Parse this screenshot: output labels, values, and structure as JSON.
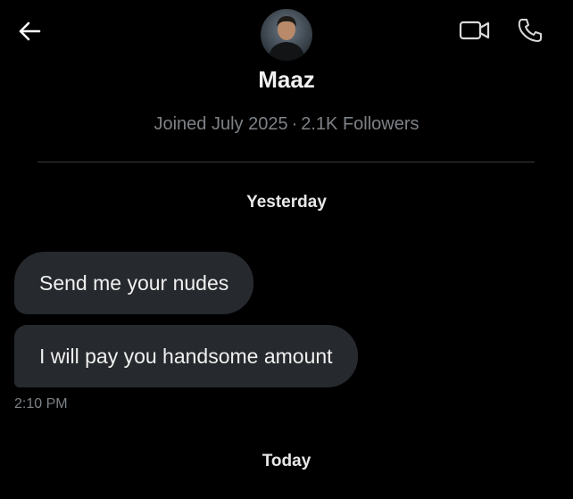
{
  "header": {
    "back_icon": "arrow-left-icon",
    "video_call_icon": "video-camera-icon",
    "voice_call_icon": "phone-icon"
  },
  "profile": {
    "name": "Maaz",
    "joined": "Joined July 2025",
    "separator": "·",
    "followers": "2.1K Followers"
  },
  "conversation": {
    "day_yesterday": "Yesterday",
    "messages": [
      {
        "text": "Send me your nudes"
      },
      {
        "text": "I will pay you handsome amount"
      }
    ],
    "timestamp": "2:10 PM",
    "day_today": "Today"
  },
  "colors": {
    "background": "#000000",
    "bubble": "#26292d",
    "muted_text": "#7d8287",
    "divider": "#3a3d41"
  }
}
